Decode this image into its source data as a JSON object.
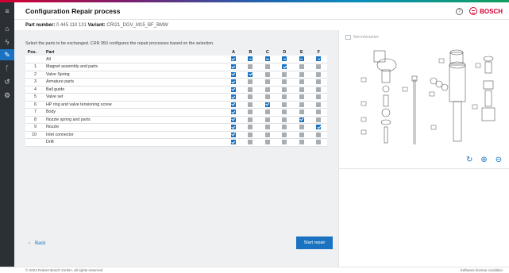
{
  "header": {
    "title": "Configuration Repair process",
    "brand": "BOSCH",
    "help_icon": "question-icon",
    "brand_icon": "bosch-armature-icon"
  },
  "part_info": {
    "part_label": "Part number:",
    "part_value": "0 445 110 131",
    "variant_label": "Variant:",
    "variant_value": "CRI21_DGV_M15_BF_BMW"
  },
  "instruction": "Select the parts to be exchanged. CRR 950 configures the repair processes based on the selection.",
  "table": {
    "headers": {
      "pos": "Pos.",
      "part": "Part",
      "cols": [
        "A",
        "B",
        "C",
        "D",
        "E",
        "F"
      ]
    },
    "rows": [
      {
        "pos": "",
        "part": "All",
        "states": [
          "on",
          "dash",
          "dash",
          "dash",
          "dash",
          "dash"
        ]
      },
      {
        "pos": "1",
        "part": "Magnet assembly and parts",
        "states": [
          "on",
          "off",
          "off",
          "on",
          "off",
          "off"
        ]
      },
      {
        "pos": "2",
        "part": "Valve Spring",
        "states": [
          "on",
          "on",
          "off",
          "off",
          "off",
          "off"
        ]
      },
      {
        "pos": "3",
        "part": "Armature parts",
        "states": [
          "on",
          "off",
          "off",
          "off",
          "off",
          "off"
        ]
      },
      {
        "pos": "4",
        "part": "Ball guide",
        "states": [
          "on",
          "off",
          "off",
          "off",
          "off",
          "off"
        ]
      },
      {
        "pos": "5",
        "part": "Valve set",
        "states": [
          "on",
          "off",
          "off",
          "off",
          "off",
          "off"
        ]
      },
      {
        "pos": "6",
        "part": "HP ring and valve tensioning screw",
        "states": [
          "on",
          "off",
          "on",
          "off",
          "off",
          "off"
        ]
      },
      {
        "pos": "7",
        "part": "Body",
        "states": [
          "on",
          "off",
          "off",
          "off",
          "off",
          "off"
        ]
      },
      {
        "pos": "8",
        "part": "Nozzle spring and parts",
        "states": [
          "on",
          "off",
          "off",
          "off",
          "on",
          "off"
        ]
      },
      {
        "pos": "9",
        "part": "Nozzle",
        "states": [
          "on",
          "off",
          "off",
          "off",
          "off",
          "on"
        ]
      },
      {
        "pos": "10",
        "part": "Inlet connector",
        "states": [
          "on",
          "off",
          "off",
          "off",
          "off",
          "off"
        ]
      },
      {
        "pos": "",
        "part": "Drift",
        "states": [
          "on",
          "off",
          "off",
          "off",
          "off",
          "off"
        ]
      }
    ]
  },
  "actions": {
    "back_label": "Back",
    "start_label": "Start repair"
  },
  "viewer": {
    "not_interactive": "Not interactive"
  },
  "footer": {
    "copyright": "© 2024 Robert Bosch GmbH, all rights reserved",
    "license": "Software license condition"
  },
  "nav": {
    "icons": [
      "menu-icon",
      "home-icon",
      "flash-icon",
      "wrench-icon",
      "tools-icon",
      "history-icon",
      "settings-icon"
    ]
  },
  "colors": {
    "accent": "#1a73c1",
    "brand": "#d3002f",
    "rail": "#2b3036"
  }
}
